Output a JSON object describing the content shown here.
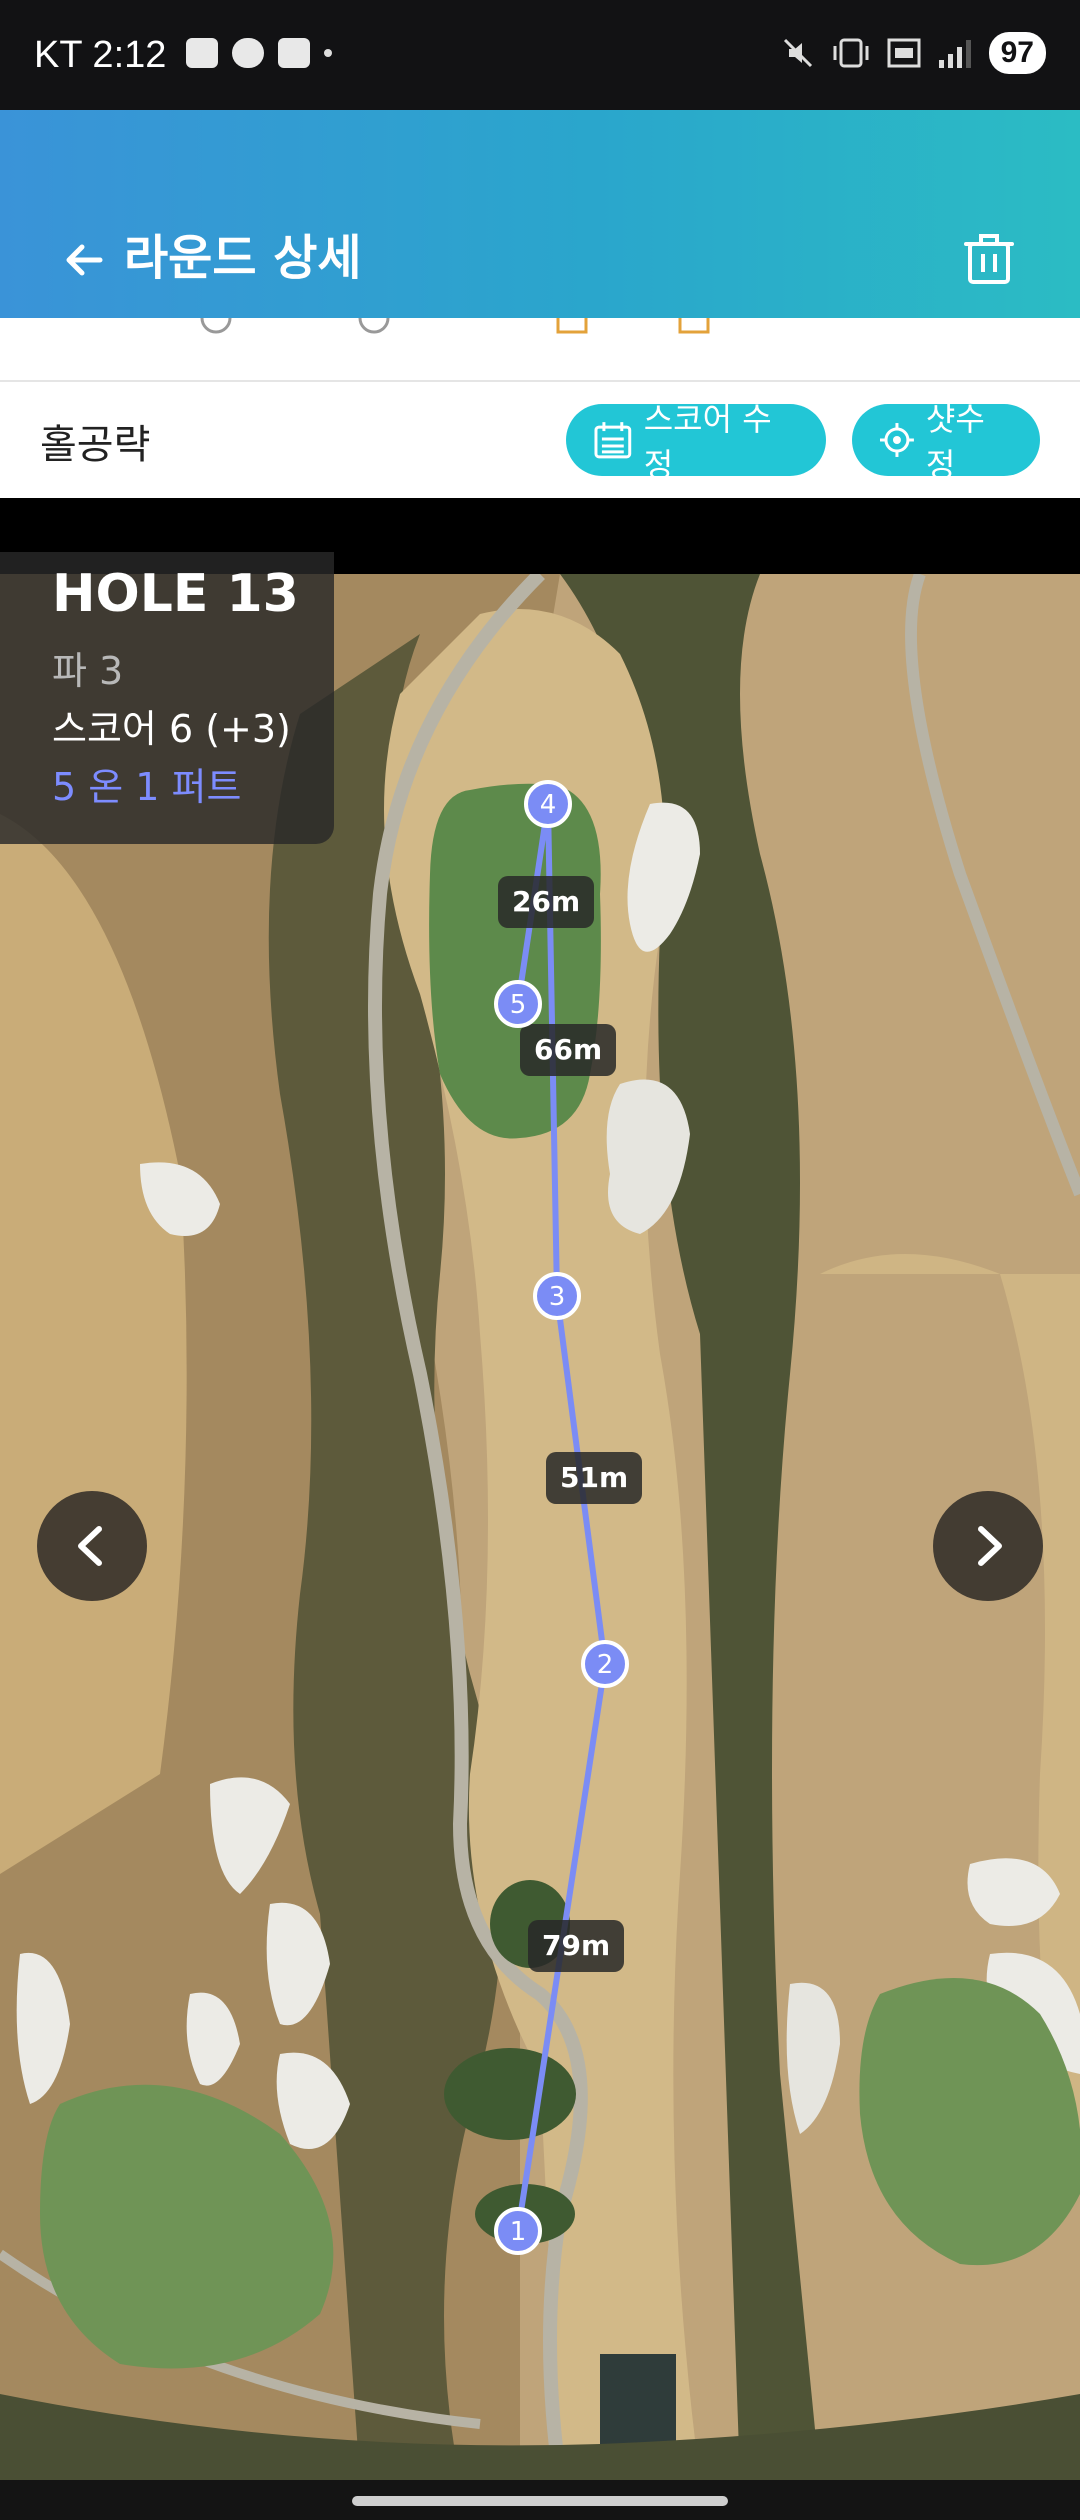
{
  "status_bar": {
    "time": "KT 2:12",
    "battery": "97",
    "left_icons": [
      "screenshot-icon",
      "chat-icon",
      "people-icon",
      "dot-icon"
    ],
    "right_icons": [
      "mute-icon",
      "vibrate-icon",
      "lte-icon",
      "signal-icon"
    ]
  },
  "app_bar": {
    "title": "라운드 상세",
    "back_icon": "arrow-left-icon",
    "action_icon": "trash-icon"
  },
  "strategy": {
    "title": "홀공략",
    "score_edit_label": "스코어 수정",
    "shot_edit_label": "샷수정"
  },
  "hole": {
    "title": "HOLE 13",
    "par": "파 3",
    "score": "스코어 6 (+3)",
    "gir": "5 온 1 퍼트"
  },
  "shots": [
    {
      "number": "1"
    },
    {
      "number": "2"
    },
    {
      "number": "3"
    },
    {
      "number": "4"
    },
    {
      "number": "5"
    }
  ],
  "distances": [
    "79m",
    "51m",
    "66m",
    "26m"
  ],
  "colors": {
    "accent": "#22c6d6",
    "shot_marker": "#7b8cf5",
    "gir_text": "#7d8cff"
  }
}
